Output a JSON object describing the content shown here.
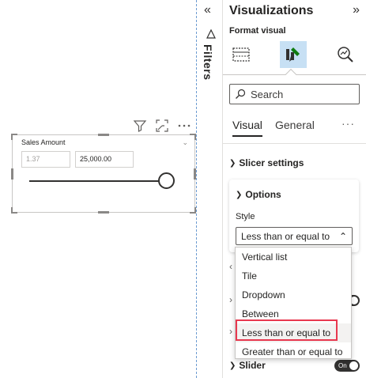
{
  "slicer": {
    "title": "Sales Amount",
    "min_value": "1.37",
    "max_value": "25,000.00",
    "slider_position": 1.0
  },
  "filters": {
    "label": "Filters"
  },
  "pane": {
    "title": "Visualizations",
    "subtitle": "Format visual",
    "search_placeholder": "Search",
    "tabs": [
      {
        "label": "Visual",
        "active": true
      },
      {
        "label": "General",
        "active": false
      }
    ],
    "more_label": "···",
    "section_title": "Slicer settings",
    "options_title": "Options",
    "style_label": "Style",
    "style_value": "Less than or equal to",
    "slider_label": "Slider",
    "slider_toggle": "On"
  },
  "dropdown": {
    "options": [
      "Vertical list",
      "Tile",
      "Dropdown",
      "Between",
      "Less than or equal to",
      "Greater than or equal to"
    ],
    "selected_index": 4
  },
  "colors": {
    "accent": "#c7e0f4",
    "highlight": "#e8384f",
    "toggle": "#323130"
  }
}
